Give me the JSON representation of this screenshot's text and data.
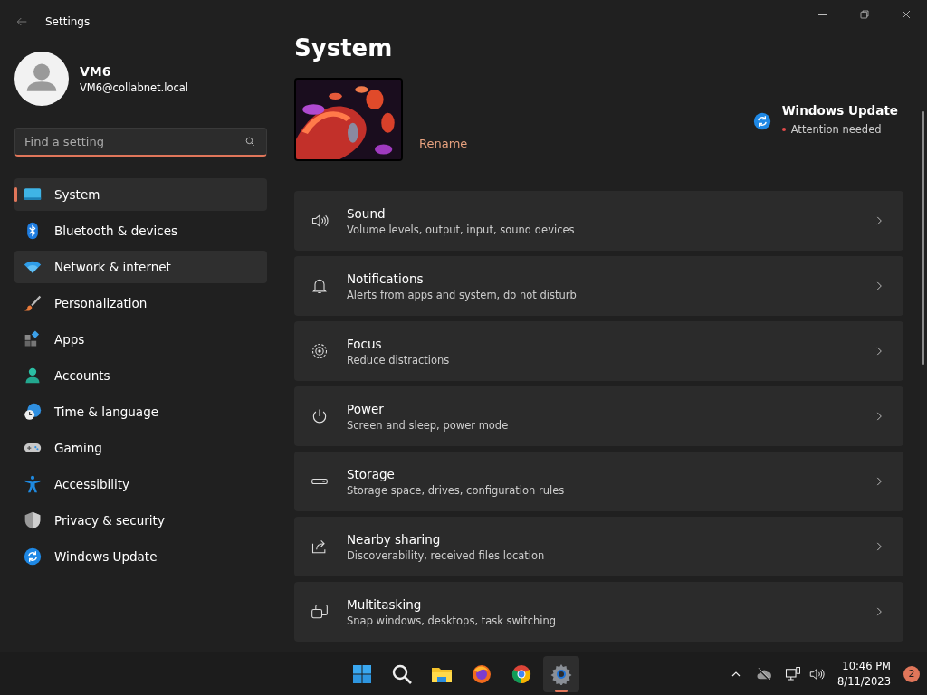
{
  "window": {
    "title": "Settings"
  },
  "profile": {
    "name": "VM6",
    "email": "VM6@collabnet.local"
  },
  "search": {
    "placeholder": "Find a setting"
  },
  "sidebar": {
    "items": [
      {
        "label": "System",
        "kind": "system",
        "selected": true,
        "hovered": false
      },
      {
        "label": "Bluetooth & devices",
        "kind": "bluetooth",
        "selected": false,
        "hovered": false
      },
      {
        "label": "Network & internet",
        "kind": "network",
        "selected": false,
        "hovered": true
      },
      {
        "label": "Personalization",
        "kind": "brush",
        "selected": false,
        "hovered": false
      },
      {
        "label": "Apps",
        "kind": "apps",
        "selected": false,
        "hovered": false
      },
      {
        "label": "Accounts",
        "kind": "accounts",
        "selected": false,
        "hovered": false
      },
      {
        "label": "Time & language",
        "kind": "time",
        "selected": false,
        "hovered": false
      },
      {
        "label": "Gaming",
        "kind": "gaming",
        "selected": false,
        "hovered": false
      },
      {
        "label": "Accessibility",
        "kind": "accessibility",
        "selected": false,
        "hovered": false
      },
      {
        "label": "Privacy & security",
        "kind": "privacy",
        "selected": false,
        "hovered": false
      },
      {
        "label": "Windows Update",
        "kind": "update",
        "selected": false,
        "hovered": false
      }
    ]
  },
  "page": {
    "title": "System",
    "rename": "Rename",
    "update": {
      "title": "Windows Update",
      "status": "Attention needed"
    },
    "cards": [
      {
        "kind": "sound",
        "title": "Sound",
        "subtitle": "Volume levels, output, input, sound devices"
      },
      {
        "kind": "notifications",
        "title": "Notifications",
        "subtitle": "Alerts from apps and system, do not disturb"
      },
      {
        "kind": "focus",
        "title": "Focus",
        "subtitle": "Reduce distractions"
      },
      {
        "kind": "power",
        "title": "Power",
        "subtitle": "Screen and sleep, power mode"
      },
      {
        "kind": "storage",
        "title": "Storage",
        "subtitle": "Storage space, drives, configuration rules"
      },
      {
        "kind": "sharing",
        "title": "Nearby sharing",
        "subtitle": "Discoverability, received files location"
      },
      {
        "kind": "multitasking",
        "title": "Multitasking",
        "subtitle": "Snap windows, desktops, task switching"
      }
    ]
  },
  "taskbar": {
    "apps": [
      {
        "kind": "start",
        "selected": false
      },
      {
        "kind": "search",
        "selected": false
      },
      {
        "kind": "files",
        "selected": false
      },
      {
        "kind": "firefox",
        "selected": false
      },
      {
        "kind": "chrome",
        "selected": false
      },
      {
        "kind": "settings",
        "selected": true
      }
    ],
    "time": "10:46 PM",
    "date": "8/11/2023",
    "notifications": "2"
  }
}
